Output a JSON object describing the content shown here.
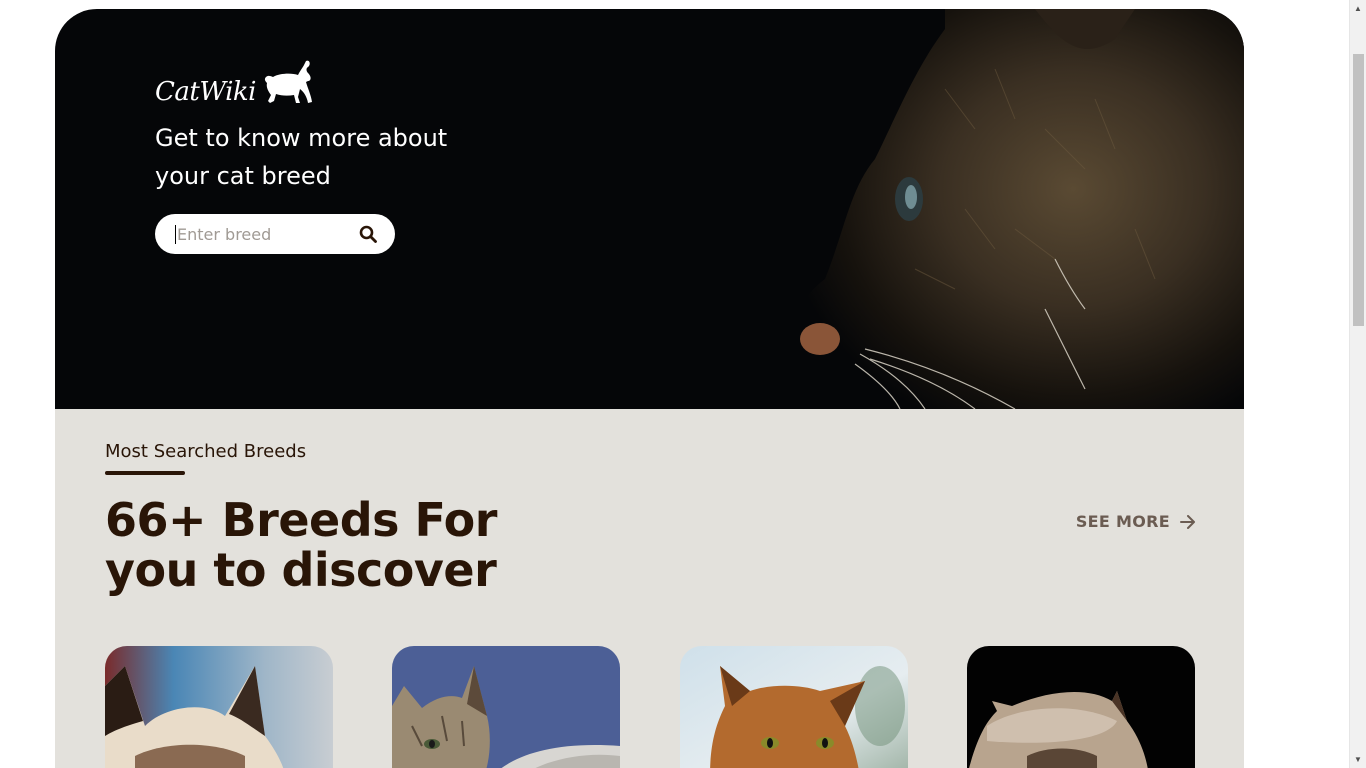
{
  "brand": {
    "logo_text": "CatWiki"
  },
  "hero": {
    "tagline": "Get to know more about your cat breed",
    "search": {
      "placeholder": "Enter breed",
      "value": ""
    },
    "icons": {
      "search": "search-icon",
      "logo": "cat-silhouette-icon"
    }
  },
  "breeds_section": {
    "label": "Most Searched Breeds",
    "heading": "66+ Breeds For you to discover",
    "see_more_label": "SEE MORE",
    "see_more_icon": "arrow-right-icon",
    "cards": [
      {
        "image": "siamese-cat-photo"
      },
      {
        "image": "tabby-kitten-photo"
      },
      {
        "image": "abyssinian-cat-photo"
      },
      {
        "image": "himalayan-cat-photo"
      }
    ]
  },
  "colors": {
    "hero_bg": "#050608",
    "section_bg": "#e3e1dc",
    "heading_text": "#291507",
    "see_more_text": "#6b5c52"
  }
}
